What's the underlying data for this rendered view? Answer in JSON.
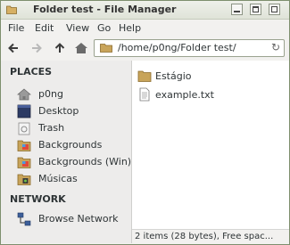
{
  "window": {
    "title": "Folder test - File Manager",
    "buttons": {
      "minimize": "minimize",
      "maximize": "maximize",
      "close": "close"
    }
  },
  "menubar": {
    "items": [
      "File",
      "Edit",
      "View",
      "Go",
      "Help"
    ]
  },
  "toolbar": {
    "path": "/home/p0ng/Folder test/"
  },
  "sidebar": {
    "places_label": "PLACES",
    "places": [
      {
        "label": "p0ng",
        "icon": "home-icon"
      },
      {
        "label": "Desktop",
        "icon": "desktop-icon"
      },
      {
        "label": "Trash",
        "icon": "trash-icon"
      },
      {
        "label": "Backgrounds",
        "icon": "folder-icon"
      },
      {
        "label": "Backgrounds (Win)",
        "icon": "folder-icon"
      },
      {
        "label": "Músicas",
        "icon": "folder-icon"
      }
    ],
    "network_label": "NETWORK",
    "network": [
      {
        "label": "Browse Network",
        "icon": "network-icon"
      }
    ]
  },
  "main": {
    "files": [
      {
        "name": "Estágio",
        "icon": "folder-icon"
      },
      {
        "name": "example.txt",
        "icon": "text-file-icon"
      }
    ]
  },
  "status": {
    "text": "2 items (28 bytes), Free spac..."
  },
  "colors": {
    "folder": "#c8a45a",
    "sidebar_bg": "#edeceb",
    "window_border": "#7e8f6e"
  }
}
